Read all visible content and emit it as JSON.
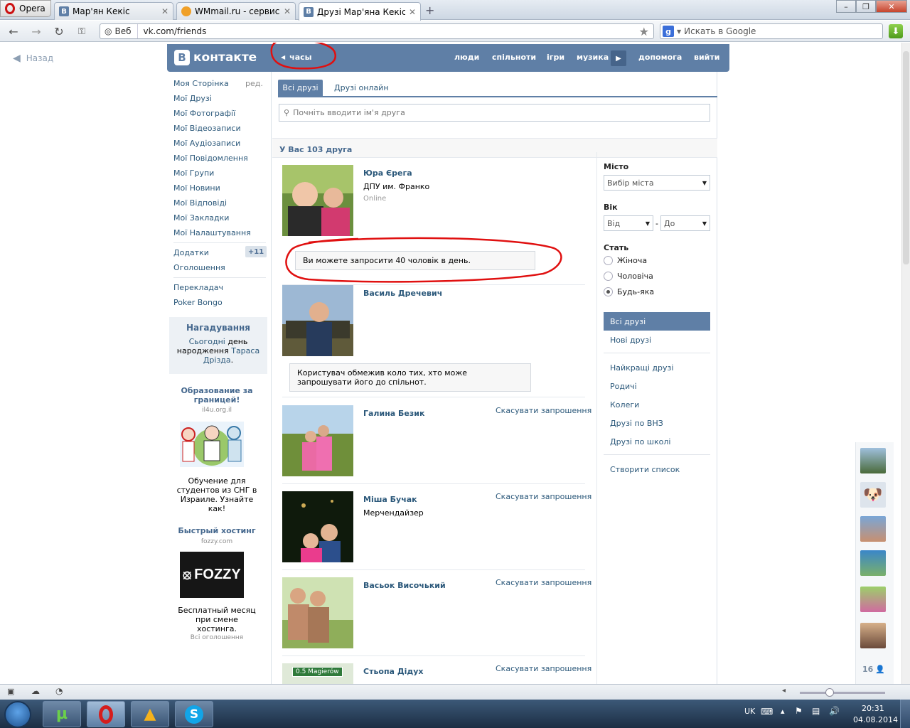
{
  "browser": {
    "menu_label": "Opera",
    "tabs": [
      {
        "title": "Мар'ян Кекіс",
        "icon": "vk-favicon"
      },
      {
        "title": "WMmail.ru - сервис п...",
        "icon": "wmmail-favicon"
      },
      {
        "title": "Друзі Мар'яна Кекіса |...",
        "icon": "vk-favicon"
      }
    ],
    "address_prefix": "Веб",
    "url": "vk.com/friends",
    "search_placeholder": "Искать в Google"
  },
  "page": {
    "back_label": "Назад",
    "header": {
      "logo_text": "контакте",
      "logo_letter": "В",
      "clock_label": "часы",
      "nav": [
        "люди",
        "спільноти",
        "ігри",
        "музика",
        "допомога",
        "вийти"
      ]
    },
    "left_menu": {
      "items": [
        "Моя Сторінка",
        "Мої Друзі",
        "Мої Фотографії",
        "Мої Відеозаписи",
        "Мої Аудіозаписи",
        "Мої Повідомлення",
        "Мої Групи",
        "Мої Новини",
        "Мої Відповіді",
        "Мої Закладки",
        "Мої Налаштування"
      ],
      "edit_label": "ред.",
      "apps_label": "Додатки",
      "apps_badge": "+11",
      "ads_label": "Оголошення",
      "extra_items": [
        "Перекладач",
        "Poker Bongo"
      ]
    },
    "reminder": {
      "title": "Нагадування",
      "today": "Сьогодні",
      "text1": " день народження ",
      "name": "Тараса Дрізда",
      "end": "."
    },
    "ads": [
      {
        "title": "Образование за границей!",
        "url": "il4u.org.il",
        "text": "Обучение для студентов из СНГ в Израиле. Узнайте как!"
      },
      {
        "title": "Быстрый хостинг",
        "url": "fozzy.com",
        "brand": "FOZZY",
        "text": "Бесплатный месяц при смене хостинга."
      }
    ],
    "all_ads_label": "Всі оголошення",
    "tabs": {
      "all": "Всі друзі",
      "online": "Друзі онлайн"
    },
    "search_placeholder": "Почніть вводити ім'я друга",
    "count_label": "У Вас 103 друга",
    "friends": [
      {
        "name": "Юра Єрега",
        "sub": "ДПУ им. Франко",
        "status": "Online",
        "notice": "Ви можете запросити 40 чоловік в день."
      },
      {
        "name": "Василь Дречевич",
        "notice": "Користувач обмежив коло тих, хто може запрошувати його до спільнот."
      },
      {
        "name": "Галина Безик",
        "action": "Скасувати запрошення"
      },
      {
        "name": "Міша Бучак",
        "sub": "Мерчендайзер",
        "action": "Скасувати запрошення"
      },
      {
        "name": "Васьок Височький",
        "action": "Скасувати запрошення"
      },
      {
        "name": "Стьопа Дідух",
        "action": "Скасувати запрошення",
        "sign_text": "0.5 Magierów"
      }
    ],
    "filters": {
      "city_label": "Місто",
      "city_value": "Вибір міста",
      "age_label": "Вік",
      "age_from": "Від",
      "age_dash": "-",
      "age_to": "До",
      "sex_label": "Стать",
      "sex_options": [
        "Жіноча",
        "Чоловіча",
        "Будь-яка"
      ],
      "sex_selected": "Будь-яка",
      "lists": [
        "Всі друзі",
        "Нові друзі"
      ],
      "lists2": [
        "Найкращі друзі",
        "Родичі",
        "Колеги",
        "Друзі по ВНЗ",
        "Друзі по школі"
      ],
      "create_list": "Створити список"
    },
    "mini_online_count": "16"
  },
  "taskbar": {
    "lang": "UK",
    "time": "20:31",
    "date": "04.08.2014"
  },
  "colors": {
    "vk_blue": "#5f7fa6",
    "link": "#2b587a",
    "annotation_red": "#e01010"
  }
}
